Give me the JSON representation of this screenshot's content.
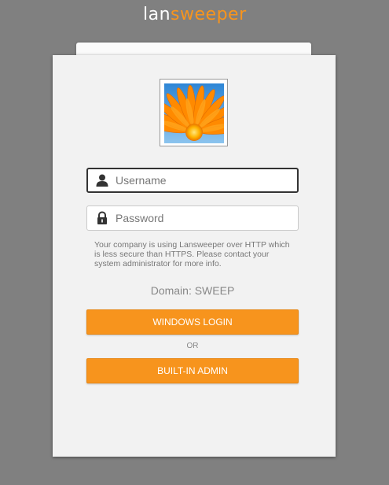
{
  "brand": {
    "logo_part1": "lan",
    "logo_part2": "sweeper",
    "primary_color": "#f7941d",
    "background_color": "#808080"
  },
  "login": {
    "avatar_icon": "flower-photo",
    "username": {
      "placeholder": "Username",
      "value": "",
      "icon": "user-icon"
    },
    "password": {
      "placeholder": "Password",
      "value": "",
      "icon": "lock-icon"
    },
    "security_notice": "Your company is using Lansweeper over HTTP which is less secure than HTTPS. Please contact your system administrator for more info.",
    "domain_text": "Domain: SWEEP",
    "windows_login_label": "WINDOWS LOGIN",
    "or_text": "OR",
    "builtin_admin_label": "BUILT-IN ADMIN"
  }
}
